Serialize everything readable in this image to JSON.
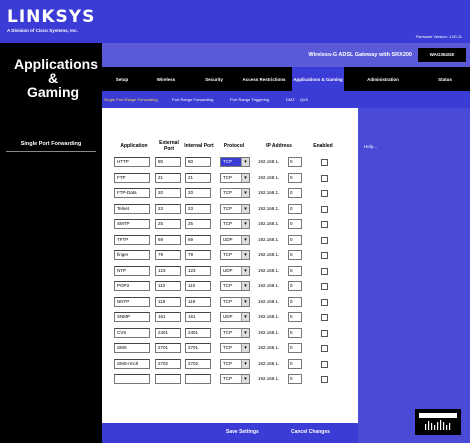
{
  "brand": {
    "logo": "LINKSYS",
    "subtitle": "A Division of Cisco Systems, Inc.",
    "firmware": "Firmware Version: 1.00.11"
  },
  "section": {
    "title_line1": "Applications &",
    "title_line2": "Gaming"
  },
  "product": {
    "name": "Wireless-G ADSL Gateway with SRX200",
    "model": "WAG354GE"
  },
  "tabs": [
    {
      "label": "Setup"
    },
    {
      "label": "Wireless"
    },
    {
      "label": "Security"
    },
    {
      "label": "Access Restrictions"
    },
    {
      "label": "Applications & Gaming"
    },
    {
      "label": "Administration"
    },
    {
      "label": "Status"
    }
  ],
  "subtabs": [
    {
      "label": "Single Port Range Forwarding"
    },
    {
      "label": "Port Range Forwarding"
    },
    {
      "label": "Port Range Triggering"
    },
    {
      "label": "DMZ"
    },
    {
      "label": "QoS"
    }
  ],
  "sidebar": {
    "label": "Single Port Forwarding"
  },
  "help": {
    "label": "Help..."
  },
  "table": {
    "headers": {
      "application": "Application",
      "external": "External Port",
      "internal": "Internal Port",
      "protocol": "Protocol",
      "ip": "IP Address",
      "enabled": "Enabled"
    },
    "ip_prefix": "192.168.1.",
    "rows": [
      {
        "app": "HTTP",
        "ext": "80",
        "int": "80",
        "proto": "TCP",
        "ip": "0"
      },
      {
        "app": "FTP",
        "ext": "21",
        "int": "21",
        "proto": "TCP",
        "ip": "0"
      },
      {
        "app": "FTP-Data",
        "ext": "20",
        "int": "20",
        "proto": "TCP",
        "ip": "0"
      },
      {
        "app": "Telnet",
        "ext": "23",
        "int": "23",
        "proto": "TCP",
        "ip": "0"
      },
      {
        "app": "SMTP",
        "ext": "25",
        "int": "25",
        "proto": "TCP",
        "ip": "0"
      },
      {
        "app": "TFTP",
        "ext": "69",
        "int": "69",
        "proto": "UDP",
        "ip": "0"
      },
      {
        "app": "finger",
        "ext": "79",
        "int": "79",
        "proto": "TCP",
        "ip": "0"
      },
      {
        "app": "NTP",
        "ext": "123",
        "int": "123",
        "proto": "UDP",
        "ip": "0"
      },
      {
        "app": "POP3",
        "ext": "110",
        "int": "110",
        "proto": "TCP",
        "ip": "0"
      },
      {
        "app": "NNTP",
        "ext": "119",
        "int": "119",
        "proto": "TCP",
        "ip": "0"
      },
      {
        "app": "SNMP",
        "ext": "161",
        "int": "161",
        "proto": "UDP",
        "ip": "0"
      },
      {
        "app": "CVS",
        "ext": "2401",
        "int": "2401",
        "proto": "TCP",
        "ip": "0"
      },
      {
        "app": "SMS",
        "ext": "2701",
        "int": "2701",
        "proto": "TCP",
        "ip": "0"
      },
      {
        "app": "SMS-rmctl",
        "ext": "2702",
        "int": "2702",
        "proto": "TCP",
        "ip": "0"
      },
      {
        "app": "",
        "ext": "",
        "int": "",
        "proto": "TCP",
        "ip": "0"
      }
    ]
  },
  "buttons": {
    "save": "Save Settings",
    "cancel": "Cancel Changes"
  },
  "colors": {
    "brand_blue": "#3b3bd6",
    "bar_blue": "#5a5ad8",
    "active_subtab": "#ffd84a"
  },
  "icons": {
    "protocol_dropdown": "chevron-down-icon",
    "footer_logo": "cisco-systems-logo"
  }
}
